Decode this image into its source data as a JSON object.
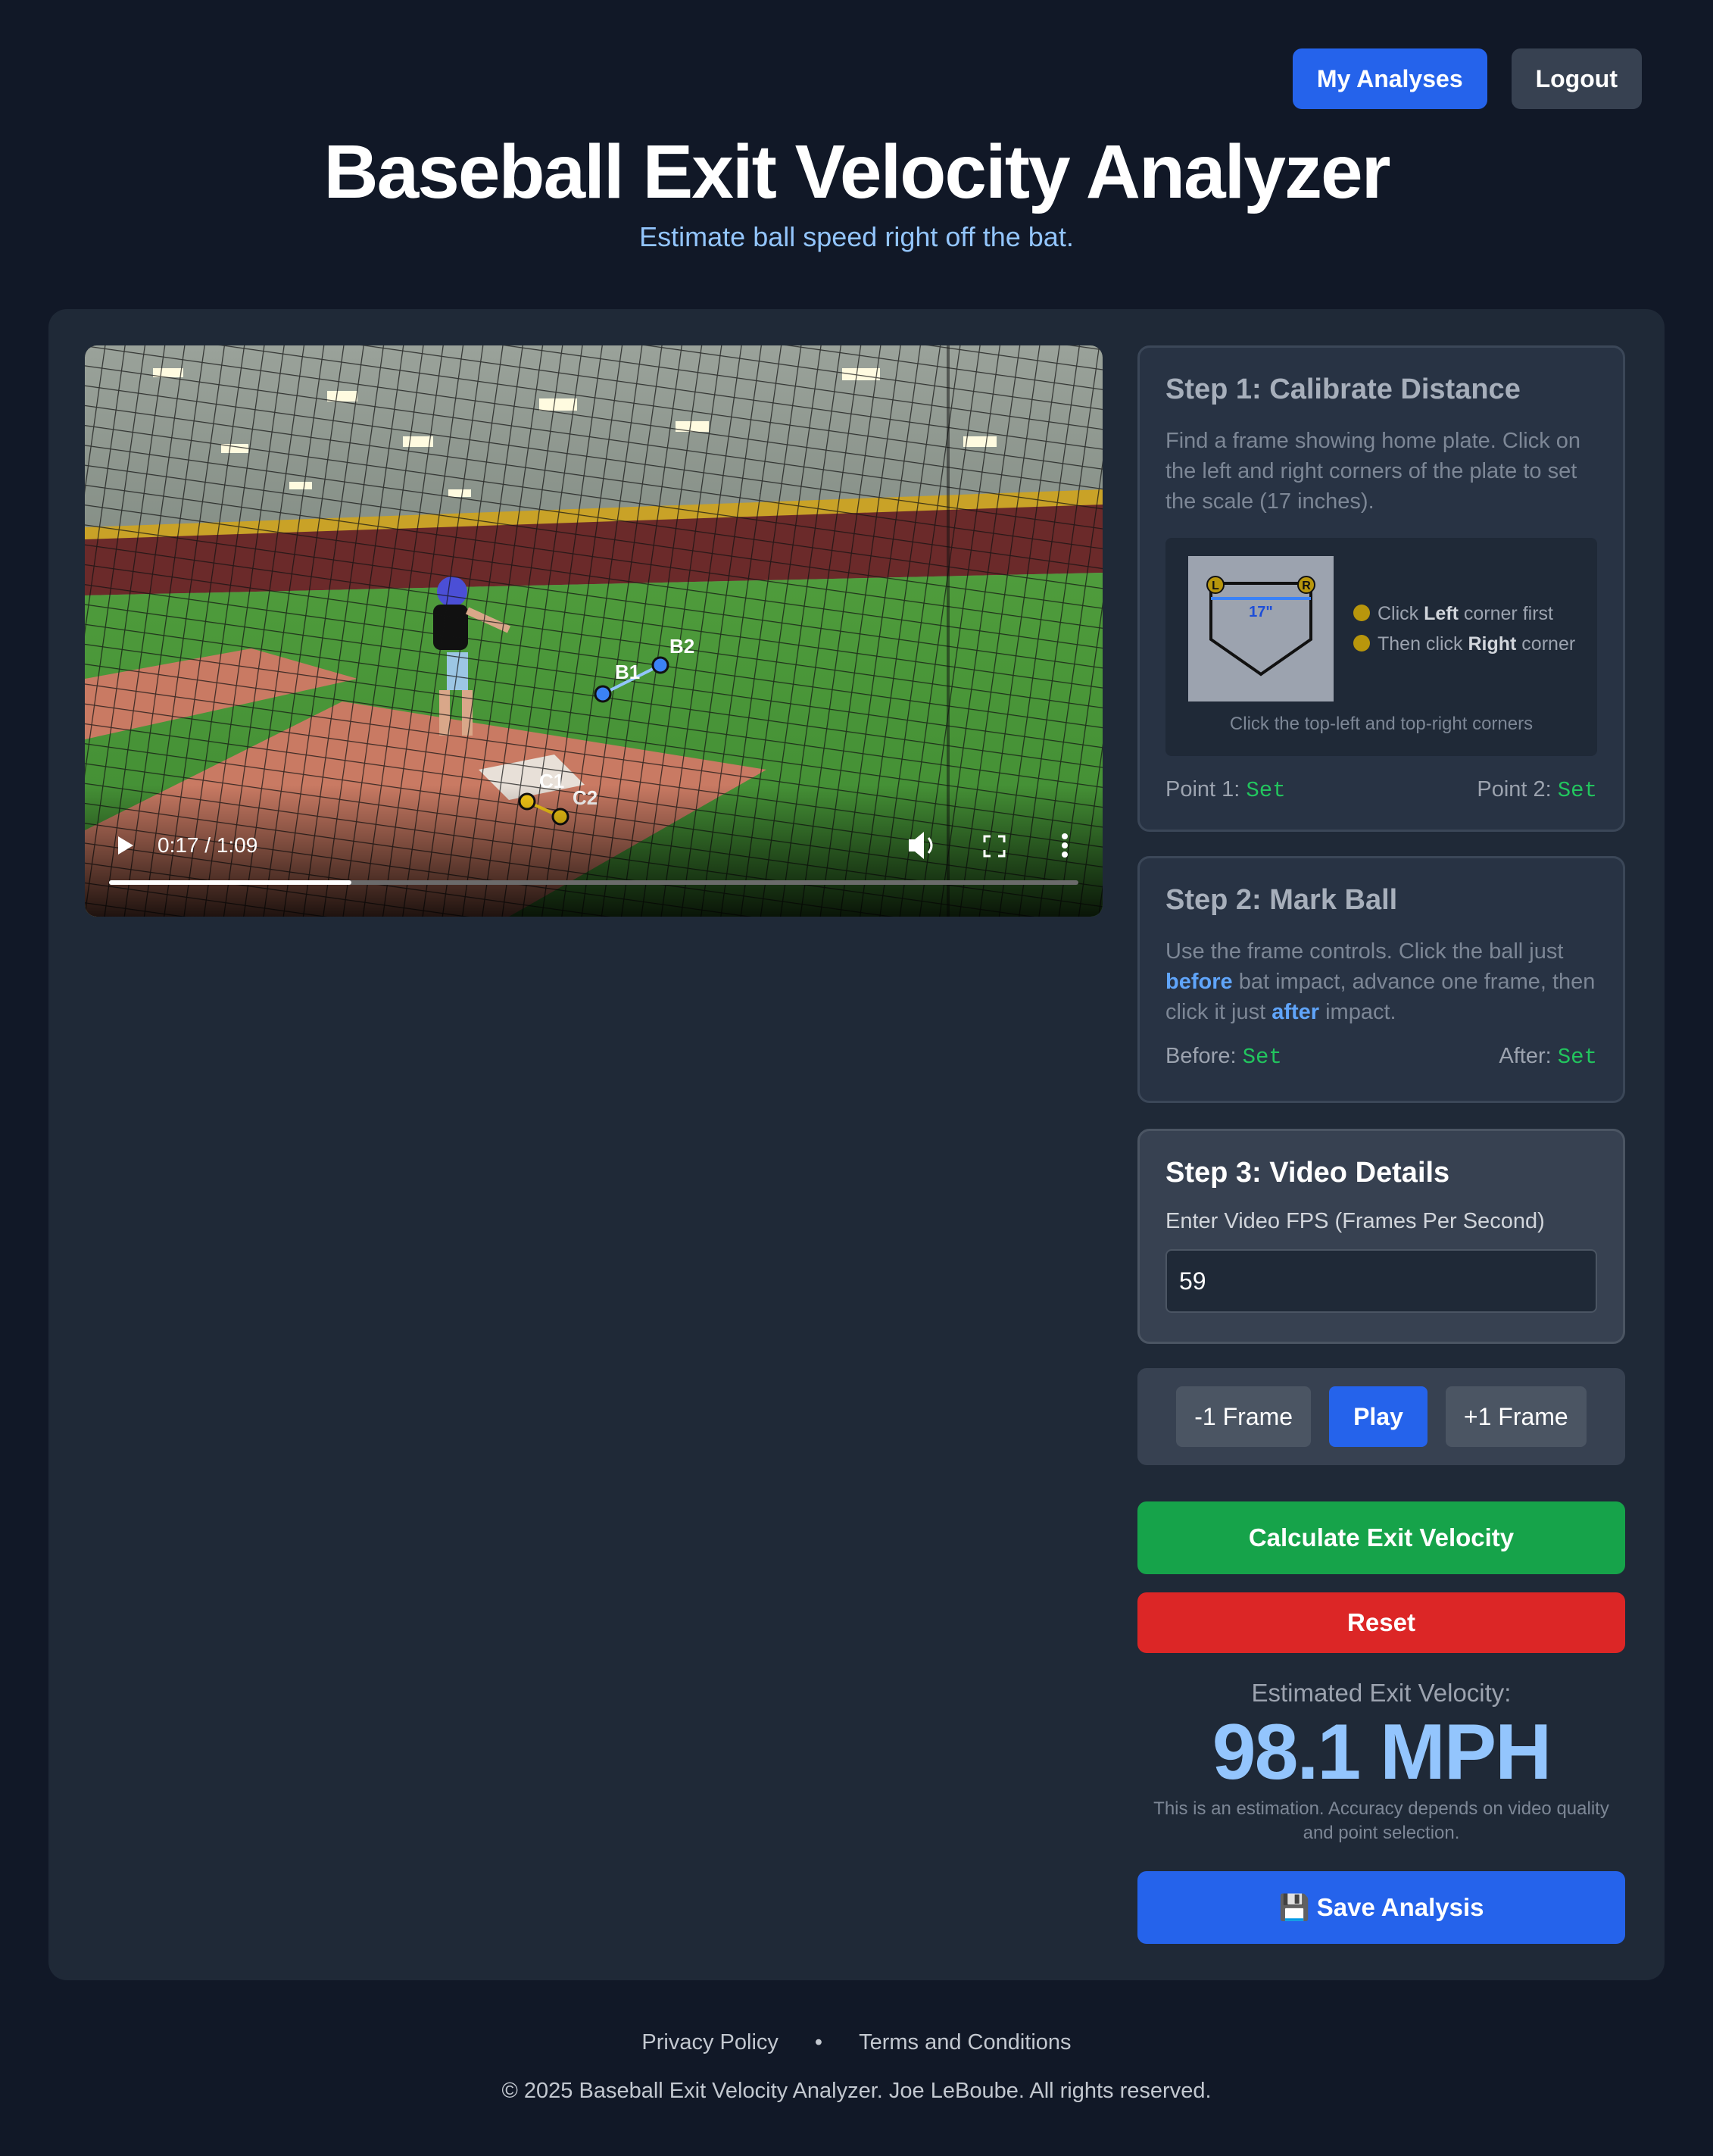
{
  "nav": {
    "my_analyses": "My Analyses",
    "logout": "Logout"
  },
  "header": {
    "title": "Baseball Exit Velocity Analyzer",
    "subtitle": "Estimate ball speed right off the bat."
  },
  "video": {
    "time": "0:17 / 1:09",
    "progress": 0.25,
    "markers": [
      {
        "label": "B1",
        "color": "#3b82f6"
      },
      {
        "label": "B2",
        "color": "#3b82f6"
      },
      {
        "label": "C1",
        "color": "#facc15"
      },
      {
        "label": "C2",
        "color": "#facc15"
      }
    ]
  },
  "step1": {
    "title": "Step 1: Calibrate Distance",
    "description": "Find a frame showing home plate. Click on the left and right corners of the plate to set the scale (17 inches).",
    "plate_width": "17\"",
    "left_marker": "L",
    "right_marker": "R",
    "legend": [
      {
        "prefix": "Click ",
        "bold": "Left",
        "suffix": " corner first"
      },
      {
        "prefix": "Then click ",
        "bold": "Right",
        "suffix": " corner"
      }
    ],
    "caption": "Click the top-left and top-right corners",
    "point1_label": "Point 1:",
    "point1_value": "Set",
    "point2_label": "Point 2:",
    "point2_value": "Set"
  },
  "step2": {
    "title": "Step 2: Mark Ball",
    "desc_part1": "Use the frame controls. Click the ball just ",
    "desc_before": "before",
    "desc_part2": " bat impact, advance one frame, then click it just ",
    "desc_after": "after",
    "desc_part3": " impact.",
    "before_label": "Before:",
    "before_value": "Set",
    "after_label": "After:",
    "after_value": "Set"
  },
  "step3": {
    "title": "Step 3: Video Details",
    "fps_label": "Enter Video FPS (Frames Per Second)",
    "fps_value": "59"
  },
  "frame_controls": {
    "prev": "-1 Frame",
    "play": "Play",
    "next": "+1 Frame"
  },
  "actions": {
    "calculate": "Calculate Exit Velocity",
    "reset": "Reset",
    "save": "💾 Save Analysis"
  },
  "result": {
    "label": "Estimated Exit Velocity:",
    "value": "98.1 MPH",
    "note": "This is an estimation. Accuracy depends on video quality and point selection."
  },
  "footer": {
    "privacy": "Privacy Policy",
    "separator": "•",
    "terms": "Terms and Conditions",
    "copyright": "© 2025 Baseball Exit Velocity Analyzer. Joe LeBoube. All rights reserved."
  }
}
